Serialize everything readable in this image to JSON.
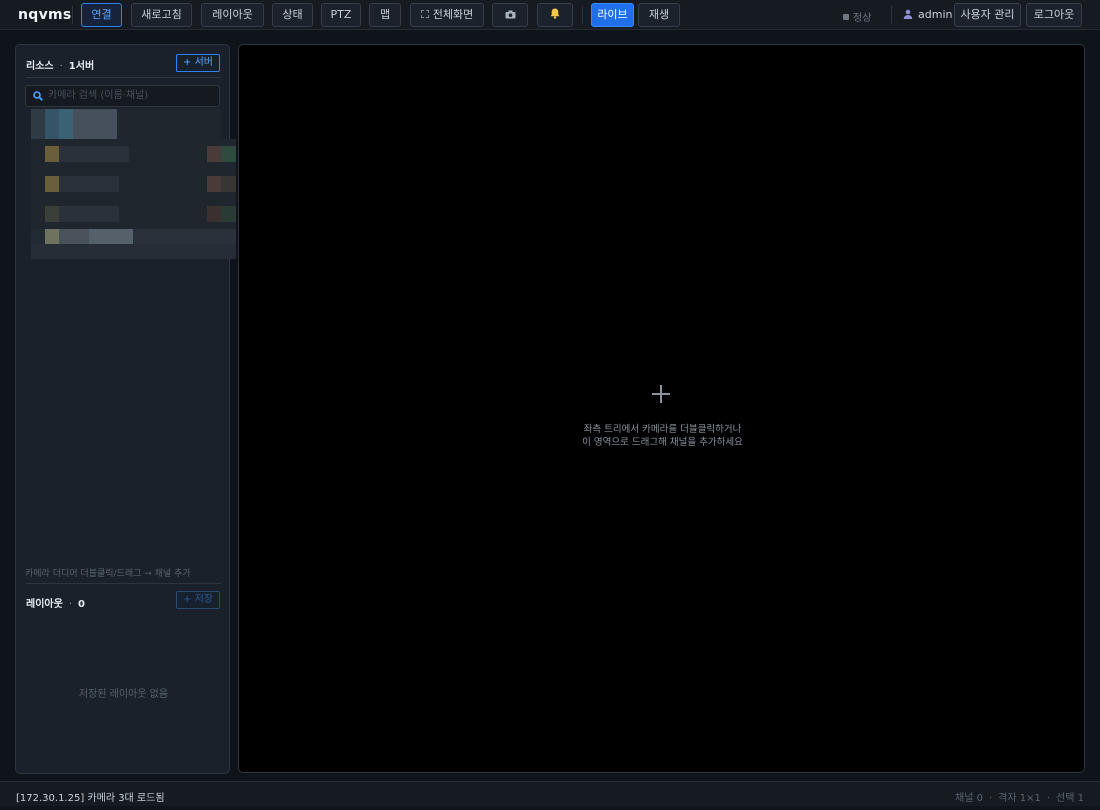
{
  "app": {
    "title": "nqvms"
  },
  "toolbar": {
    "connect": "연결",
    "refresh": "새로고침",
    "layout": "레이아웃",
    "status": "상태",
    "ptz": "PTZ",
    "map": "맵",
    "fullscreen": "전체화면",
    "fullscreen_icon": "expand-icon",
    "snapshot_icon": "camera-icon",
    "alarm_icon": "bell-icon",
    "live": "라이브",
    "playback": "재생"
  },
  "header_right": {
    "status_text": "정상",
    "user": "admin",
    "user_icon": "user-icon",
    "user_manage": "사용자 관리",
    "logout": "로그아웃"
  },
  "sidebar": {
    "resources": {
      "title": "리소스",
      "count": "1서버",
      "add_button": "+ 서버"
    },
    "search": {
      "placeholder": "카메라 검색 (이름·채널)"
    },
    "hint": "카메라 더디어 더블클릭/드래그 → 채널 추가",
    "layouts": {
      "title": "레이아웃",
      "count": "0",
      "save_button": "+ 저장",
      "empty_text": "저장된 레이아웃 없음"
    }
  },
  "viewer": {
    "empty_line1": "좌측 트리에서 카메라를 더블클릭하거나",
    "empty_line2": "이 영역으로 드래그해 채널을 추가하세요"
  },
  "footer": {
    "message": "[172.30.1.25] 카메라 3대 로드됨",
    "channels": "채널 0",
    "grid": "격자 1×1",
    "selected": "선택 1"
  },
  "colors": {
    "accent": "#2f81f7",
    "active_button": "#1f6feb",
    "background": "#0f141b",
    "panel": "#1b212a",
    "alarm": "#f2c94c"
  }
}
